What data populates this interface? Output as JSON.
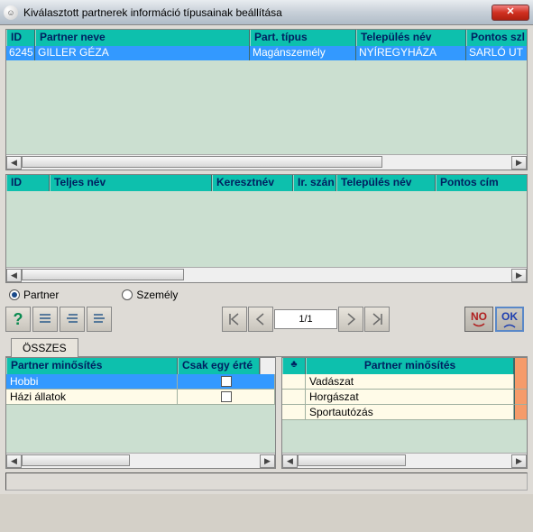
{
  "window": {
    "title": "Kiválasztott partnerek információ típusainak beállítása"
  },
  "table1": {
    "cols": [
      "ID",
      "Partner neve",
      "Part. típus",
      "Település név",
      "Pontos szl"
    ],
    "row": {
      "id": "6245",
      "nev": "GILLER GÉZA",
      "tipus": "Magánszemély",
      "telepules": "NYÍREGYHÁZA",
      "cim": "SARLÓ UT"
    }
  },
  "table2": {
    "cols": [
      "ID",
      "Teljes név",
      "Keresztnév",
      "Ir. szán",
      "Település név",
      "Pontos cím"
    ]
  },
  "radios": {
    "partner": "Partner",
    "szemely": "Személy"
  },
  "pager": "1/1",
  "buttons": {
    "no": "NO",
    "ok": "OK"
  },
  "tab": "ÖSSZES",
  "panelL": {
    "cols": [
      "Partner minősítés",
      "Csak egy érté"
    ],
    "rows": [
      "Hobbi",
      "Házi állatok"
    ]
  },
  "panelR": {
    "head_symbol": "♣",
    "head": "Partner minősítés",
    "rows": [
      "Vadászat",
      "Horgászat",
      "Sportautózás"
    ]
  }
}
